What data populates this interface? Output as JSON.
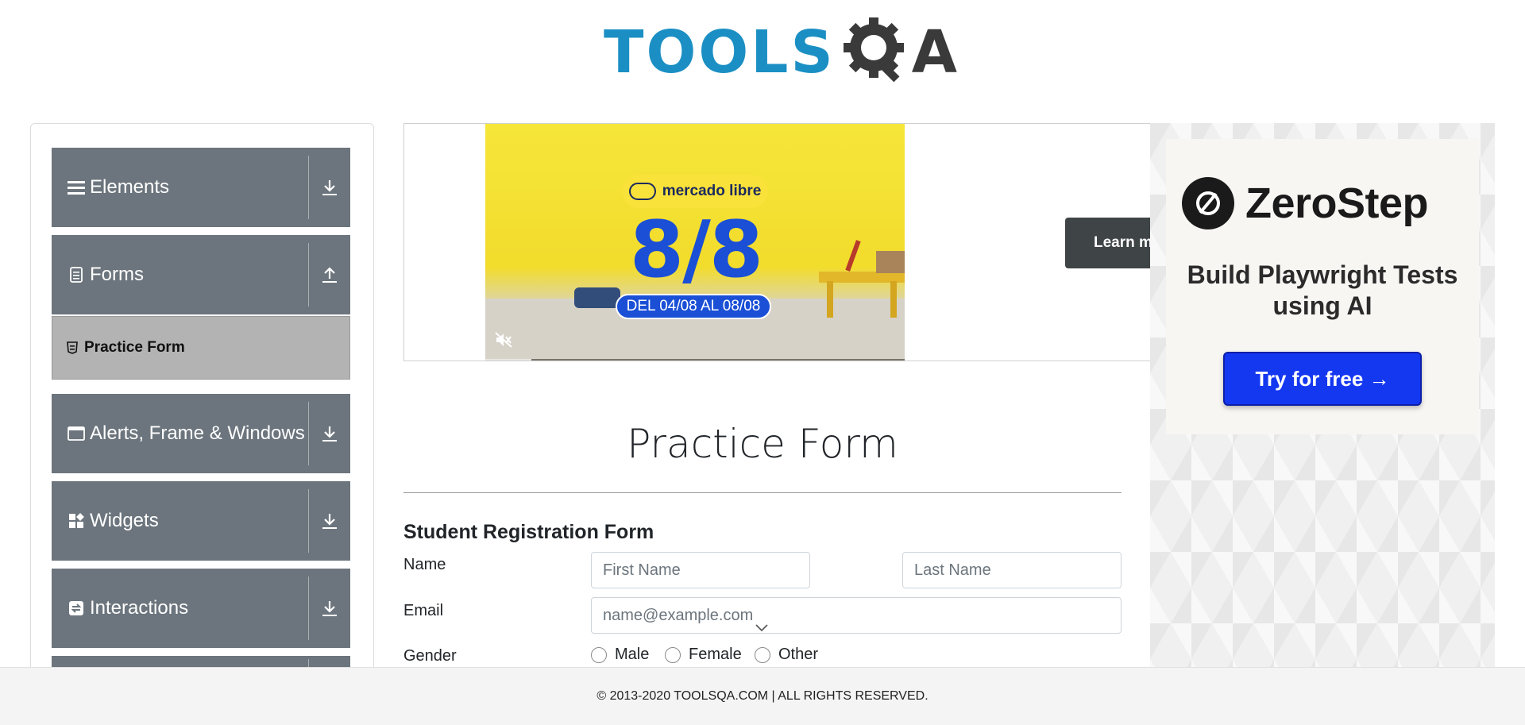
{
  "header": {
    "logo_text": "TOOLS",
    "logo_suffix": "A"
  },
  "sidebar": {
    "groups": [
      {
        "label": "Elements",
        "icon": "hamburger-icon",
        "arrow": "download-arrow-icon"
      },
      {
        "label": "Forms",
        "icon": "document-icon",
        "arrow": "upload-arrow-icon"
      },
      {
        "label": "Alerts, Frame & Windows",
        "icon": "window-icon",
        "arrow": "download-arrow-icon"
      },
      {
        "label": "Widgets",
        "icon": "widgets-icon",
        "arrow": "download-arrow-icon"
      },
      {
        "label": "Interactions",
        "icon": "interactions-icon",
        "arrow": "download-arrow-icon"
      }
    ],
    "active_item": {
      "label": "Practice Form",
      "icon": "html5-icon"
    }
  },
  "ad_banner": {
    "brand": "mercado libre",
    "headline": "8/8",
    "dates": "DEL 04/08 AL 08/08",
    "cta": "Learn more",
    "progress": 0.11,
    "muted": true
  },
  "side_ad": {
    "brand": "ZeroStep",
    "tagline": "Build Playwright Tests using AI",
    "cta": "Try for free →"
  },
  "form": {
    "page_title": "Practice Form",
    "heading": "Student Registration Form",
    "name_label": "Name",
    "first_name_placeholder": "First Name",
    "last_name_placeholder": "Last Name",
    "email_label": "Email",
    "email_placeholder": "name@example.com",
    "gender_label": "Gender",
    "gender_options": [
      "Male",
      "Female",
      "Other"
    ]
  },
  "footer": {
    "text": "© 2013-2020 TOOLSQA.COM | ALL RIGHTS RESERVED."
  }
}
